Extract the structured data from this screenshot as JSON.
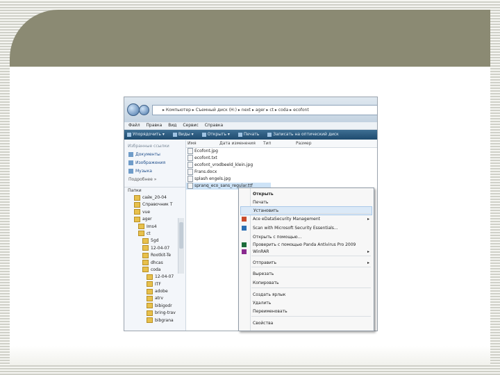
{
  "explorer": {
    "address_path": "▸ Компьютер ▸ Съемный диск (H:) ▸ next ▸ ager ▸ ct ▸ coda ▸ ecofont",
    "menu": [
      "Файл",
      "Правка",
      "Вид",
      "Сервис",
      "Справка"
    ],
    "commands": [
      "Упорядочить ▾",
      "Виды ▾",
      "Открыть ▾",
      "Печать",
      "Записать на оптический диск"
    ],
    "nav_pane": {
      "favorites_header": "Избранные ссылки",
      "links": [
        "Документы",
        "Изображения",
        "Музыка"
      ],
      "more_label": "Подробнее »",
      "folders_header": "Папки",
      "folders": [
        "сайк_20-04",
        "Справочник Т",
        "vue",
        "ager",
        "Ims4",
        "ct",
        "5gd",
        "12-04-07",
        "Rootkit-Te",
        "dhcas",
        "coda",
        "12-04-07",
        "ITF",
        "adobe",
        "atrv",
        "bibigodr",
        "bring-trav",
        "bibgrana"
      ]
    },
    "columns": [
      "Имя",
      "Дата изменения",
      "Тип",
      "Размер"
    ],
    "files": [
      "Ecofont.jpg",
      "ecofont.txt",
      "ecofont_vrodbeeld_klein.jpg",
      "Frans.docx",
      "splash engels.jpg",
      "spranq_eco_sans_regular.ttf"
    ]
  },
  "context_menu": {
    "items": [
      {
        "label": "Открыть",
        "bold": true
      },
      {
        "label": "Печать"
      },
      {
        "label": "Установить",
        "highlight": true
      },
      {
        "label": "Ace eDataSecurity Management",
        "submenu": true
      },
      {
        "label": "Scan with Microsoft Security Essentials..."
      },
      {
        "label": "Открыть с помощью..."
      },
      {
        "label": "Проверить с помощью Panda Antivirus Pro 2009"
      },
      {
        "label": "WinRAR",
        "submenu": true
      },
      {
        "label": "Отправить",
        "submenu": true
      },
      {
        "label": "Вырезать"
      },
      {
        "label": "Копировать"
      },
      {
        "label": "Создать ярлык"
      },
      {
        "label": "Удалить"
      },
      {
        "label": "Переименовать"
      },
      {
        "label": "Свойства"
      }
    ]
  },
  "colors": {
    "slide_olive": "#8b8a73",
    "cmd_bar": "#2b5a80",
    "highlight": "#dbe9f7"
  }
}
